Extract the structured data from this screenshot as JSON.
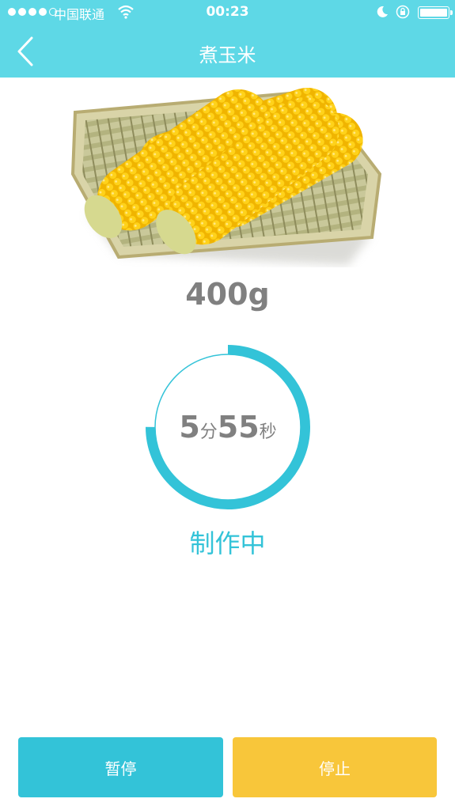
{
  "status_bar": {
    "carrier": "中国联通",
    "time": "00:23",
    "battery_level": 1.0
  },
  "nav": {
    "title": "煮玉米"
  },
  "recipe": {
    "weight": "400g",
    "minutes": "5",
    "minutes_unit": "分",
    "seconds": "55",
    "seconds_unit": "秒",
    "progress": 0.75,
    "status": "制作中"
  },
  "buttons": {
    "pause_label": "暂停",
    "stop_label": "停止"
  },
  "colors": {
    "header_bg": "#5ed8e6",
    "accent": "#33c3d8",
    "stop": "#f8c63a",
    "text_gray": "#808080"
  },
  "icons": {
    "back": "chevron-left-icon",
    "wifi": "wifi-icon",
    "moon": "moon-icon",
    "lock": "rotation-lock-icon",
    "battery": "battery-icon"
  }
}
